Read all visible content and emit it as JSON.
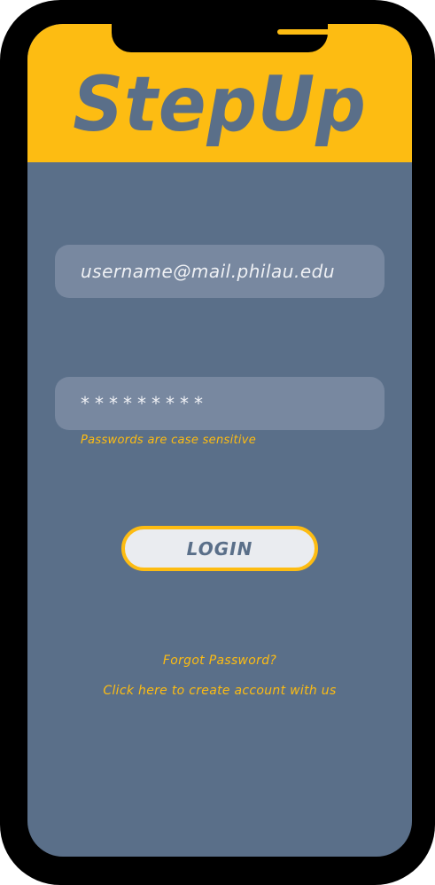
{
  "app": {
    "title": "StepUp"
  },
  "login_form": {
    "username_value": "username@mail.philau.edu",
    "password_value": "*********",
    "password_hint": "Passwords are case sensitive",
    "login_label": "LOGIN"
  },
  "links": {
    "forgot_password": "Forgot Password?",
    "create_account": "Click here to create account with us"
  },
  "colors": {
    "brand_yellow": "#fdbc12",
    "slate_blue": "#5a6f89",
    "field_fill": "#7888a0",
    "button_fill": "#eaecf0",
    "device_frame": "#000000"
  }
}
